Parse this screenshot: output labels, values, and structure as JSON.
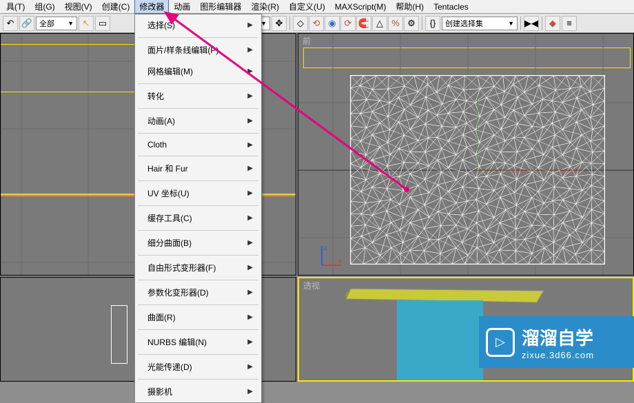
{
  "menubar": {
    "items": [
      {
        "label": "具(T)"
      },
      {
        "label": "组(G)"
      },
      {
        "label": "视图(V)"
      },
      {
        "label": "创建(C)"
      },
      {
        "label": "修改器",
        "highlighted": true
      },
      {
        "label": "动画"
      },
      {
        "label": "图形编辑器"
      },
      {
        "label": "渲染(R)"
      },
      {
        "label": "自定义(U)"
      },
      {
        "label": "MAXScript(M)"
      },
      {
        "label": "帮助(H)"
      },
      {
        "label": "Tentacles"
      }
    ]
  },
  "toolbar": {
    "scope_label": "全部",
    "selset_label": "创建选择集"
  },
  "dropdown": {
    "items": [
      {
        "label": "选择(S)",
        "sub": true,
        "sep_after": true
      },
      {
        "label": "面片/样条线编辑(P)",
        "sub": true
      },
      {
        "label": "网格编辑(M)",
        "sub": true,
        "sep_after": true
      },
      {
        "label": "转化",
        "sub": true,
        "sep_after": true
      },
      {
        "label": "动画(A)",
        "sub": true,
        "sep_after": true
      },
      {
        "label": "Cloth",
        "sub": true,
        "sep_after": true
      },
      {
        "label": "Hair 和 Fur",
        "sub": true,
        "sep_after": true
      },
      {
        "label": "UV 坐标(U)",
        "sub": true,
        "sep_after": true
      },
      {
        "label": "缓存工具(C)",
        "sub": true,
        "sep_after": true
      },
      {
        "label": "细分曲面(B)",
        "sub": true,
        "sep_after": true
      },
      {
        "label": "自由形式变形器(F)",
        "sub": true,
        "sep_after": true
      },
      {
        "label": "参数化变形器(D)",
        "sub": true,
        "sep_after": true
      },
      {
        "label": "曲面(R)",
        "sub": true,
        "sep_after": true
      },
      {
        "label": "NURBS 编辑(N)",
        "sub": true,
        "sep_after": true
      },
      {
        "label": "光能传递(D)",
        "sub": true,
        "sep_after": true
      },
      {
        "label": "摄影机",
        "sub": true
      }
    ]
  },
  "viewports": {
    "top_right_label": "前",
    "bottom_right_label": "透视",
    "axis_x": "x",
    "axis_z": "z"
  },
  "watermark": {
    "title": "溜溜自学",
    "sub": "zixue.3d66.com",
    "play": "▷"
  }
}
